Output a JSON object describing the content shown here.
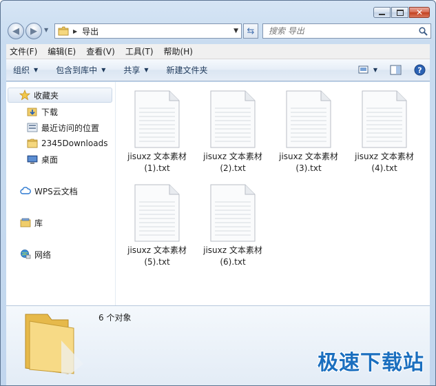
{
  "address": {
    "crumb": "导出"
  },
  "search": {
    "placeholder": "搜索 导出"
  },
  "menu": [
    "文件(F)",
    "编辑(E)",
    "查看(V)",
    "工具(T)",
    "帮助(H)"
  ],
  "toolbar": {
    "organize": "组织",
    "include_library": "包含到库中",
    "share": "共享",
    "new_folder": "新建文件夹"
  },
  "sidebar": {
    "favorites": "收藏夹",
    "items": [
      "下载",
      "最近访问的位置",
      "2345Downloads",
      "桌面"
    ],
    "wps": "WPS云文档",
    "library": "库",
    "network": "网络"
  },
  "files": [
    {
      "line1": "jisuxz 文本素材",
      "line2": "(1).txt"
    },
    {
      "line1": "jisuxz 文本素材",
      "line2": "(2).txt"
    },
    {
      "line1": "jisuxz 文本素材",
      "line2": "(3).txt"
    },
    {
      "line1": "jisuxz 文本素材",
      "line2": "(4).txt"
    },
    {
      "line1": "jisuxz 文本素材",
      "line2": "(5).txt"
    },
    {
      "line1": "jisuxz 文本素材",
      "line2": "(6).txt"
    }
  ],
  "details": {
    "count": "6 个对象"
  },
  "watermark": "极速下载站",
  "icons": {
    "back": "back-arrow-icon",
    "forward": "forward-arrow-icon",
    "refresh": "refresh-icon",
    "search": "magnifier-icon",
    "help": "help-icon"
  },
  "colors": {
    "accent": "#1b6fbf",
    "command_text": "#1e395b",
    "close_button": "#c3401e"
  }
}
